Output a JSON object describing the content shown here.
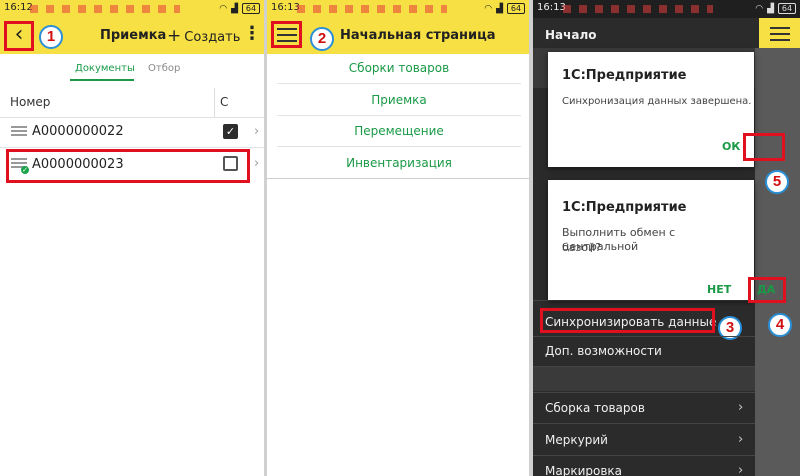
{
  "screen1": {
    "time": "16:12",
    "battery": "64",
    "title": "Приемка",
    "create_label": "Создать",
    "tabs": [
      "Документы",
      "Отбор"
    ],
    "columns": [
      "Номер",
      "С"
    ],
    "rows": [
      {
        "number": "A0000000022",
        "checked": true
      },
      {
        "number": "A0000000023",
        "checked": false
      }
    ],
    "badge": "1"
  },
  "screen2": {
    "time": "16:13",
    "battery": "64",
    "title": "Начальная страница",
    "menu": [
      "Сборки товаров",
      "Приемка",
      "Перемещение",
      "Инвентаризация"
    ],
    "badge": "2"
  },
  "screen3": {
    "time": "16:13",
    "battery": "64",
    "title": "Начало",
    "dialog1": {
      "title": "1С:Предприятие",
      "message": "Синхронизация данных завершена.",
      "ok": "ОК"
    },
    "dialog2": {
      "title": "1С:Предприятие",
      "message_line1": "Выполнить обмен с центральной",
      "message_line2": "базой?",
      "no": "НЕТ",
      "yes": "ДА"
    },
    "drawer": {
      "sync": "Синхронизировать данные",
      "extra": "Доп. возможности",
      "assembly": "Сборка товаров",
      "mercury": "Меркурий",
      "marking": "Маркировка"
    },
    "badges": [
      "3",
      "4",
      "5"
    ]
  },
  "colors": {
    "accent_yellow": "#f7e043",
    "highlight_red": "#e01020",
    "link_green": "#1a9a46",
    "badge_blue": "#2a8fd6"
  }
}
